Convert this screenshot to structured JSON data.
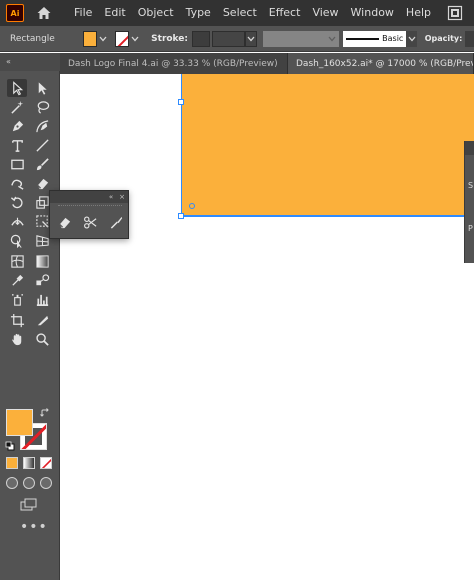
{
  "app": {
    "logo_text": "Ai",
    "accent_color": "#fbb03b",
    "stroke_none_color": "#e21f26",
    "selection_color": "#2e8bff"
  },
  "menu": {
    "items": [
      "File",
      "Edit",
      "Object",
      "Type",
      "Select",
      "Effect",
      "View",
      "Window",
      "Help"
    ]
  },
  "control_bar": {
    "selection_label": "Rectangle",
    "stroke_label": "Stroke:",
    "brush_label": "Basic",
    "opacity_label": "Opacity:"
  },
  "tabs": [
    {
      "label": "Dash Logo Final 4.ai @ 33.33 % (RGB/Preview)",
      "close": "×",
      "active": false
    },
    {
      "label": "Dash_160x52.ai* @ 17000 % (RGB/Preview)",
      "close": "×",
      "active": true
    }
  ],
  "toolbar": {
    "collapse_glyph": "«",
    "more_glyph": "•••",
    "fill_color": "#fbb03b"
  },
  "flyout": {
    "collapse_glyph": "«",
    "close_glyph": "×",
    "tools": [
      "eraser-icon",
      "scissors-icon",
      "knife-icon"
    ]
  },
  "right_panel": {
    "letters": [
      "S",
      "P"
    ]
  },
  "canvas": {
    "shape_fill": "#fbb03b"
  }
}
